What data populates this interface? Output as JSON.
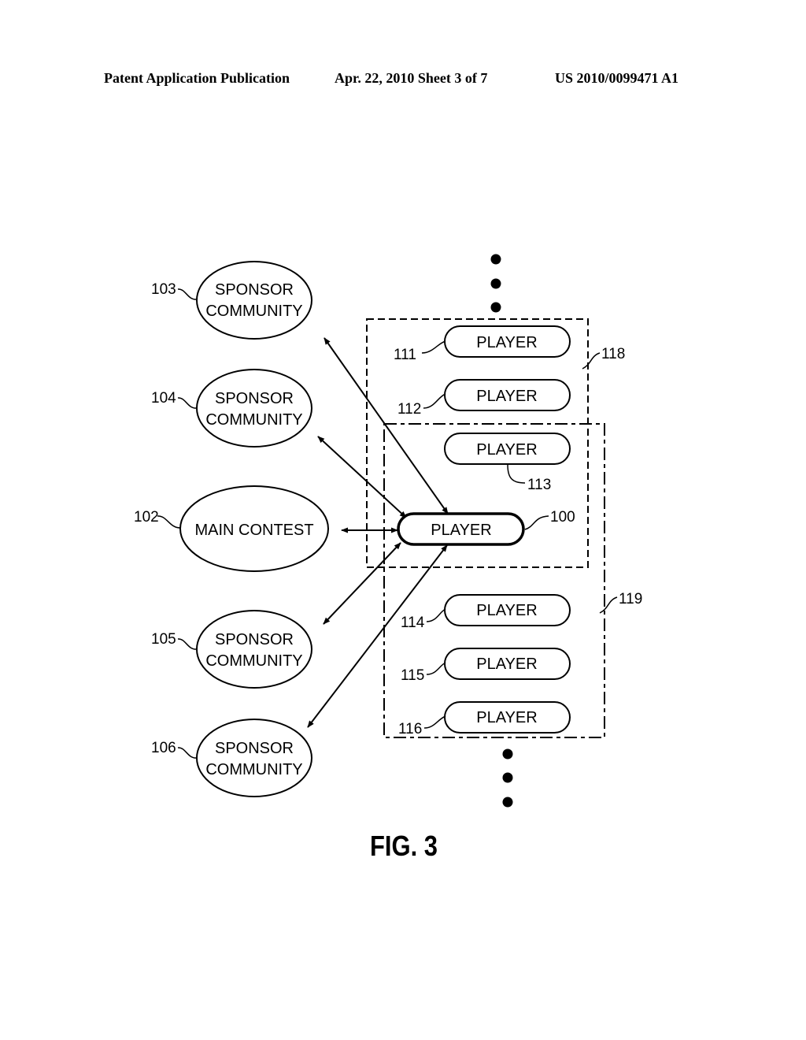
{
  "header": {
    "publication": "Patent Application Publication",
    "date_sheet": "Apr. 22, 2010  Sheet 3 of 7",
    "number": "US 2010/0099471 A1"
  },
  "figure": {
    "caption": "FIG. 3",
    "nodes": {
      "n103": {
        "ref": "103",
        "line1": "SPONSOR",
        "line2": "COMMUNITY"
      },
      "n104": {
        "ref": "104",
        "line1": "SPONSOR",
        "line2": "COMMUNITY"
      },
      "n102": {
        "ref": "102",
        "label": "MAIN CONTEST"
      },
      "n105": {
        "ref": "105",
        "line1": "SPONSOR",
        "line2": "COMMUNITY"
      },
      "n106": {
        "ref": "106",
        "line1": "SPONSOR",
        "line2": "COMMUNITY"
      },
      "p111": {
        "ref": "111",
        "label": "PLAYER"
      },
      "p112": {
        "ref": "112",
        "label": "PLAYER"
      },
      "p113": {
        "ref": "113",
        "label": "PLAYER"
      },
      "p100": {
        "ref": "100",
        "label": "PLAYER"
      },
      "p114": {
        "ref": "114",
        "label": "PLAYER"
      },
      "p115": {
        "ref": "115",
        "label": "PLAYER"
      },
      "p116": {
        "ref": "116",
        "label": "PLAYER"
      }
    },
    "groups": {
      "g118": {
        "ref": "118",
        "members": [
          "111",
          "112",
          "113",
          "100"
        ]
      },
      "g119": {
        "ref": "119",
        "members": [
          "113",
          "100",
          "114",
          "115",
          "116"
        ]
      }
    },
    "edges": [
      {
        "from": "100",
        "to": "103",
        "type": "bidirectional"
      },
      {
        "from": "100",
        "to": "104",
        "type": "bidirectional"
      },
      {
        "from": "100",
        "to": "102",
        "type": "bidirectional"
      },
      {
        "from": "100",
        "to": "105",
        "type": "bidirectional"
      },
      {
        "from": "100",
        "to": "106",
        "type": "bidirectional"
      }
    ],
    "continuation_marks": [
      "top-ellipsis",
      "bottom-ellipsis"
    ]
  }
}
